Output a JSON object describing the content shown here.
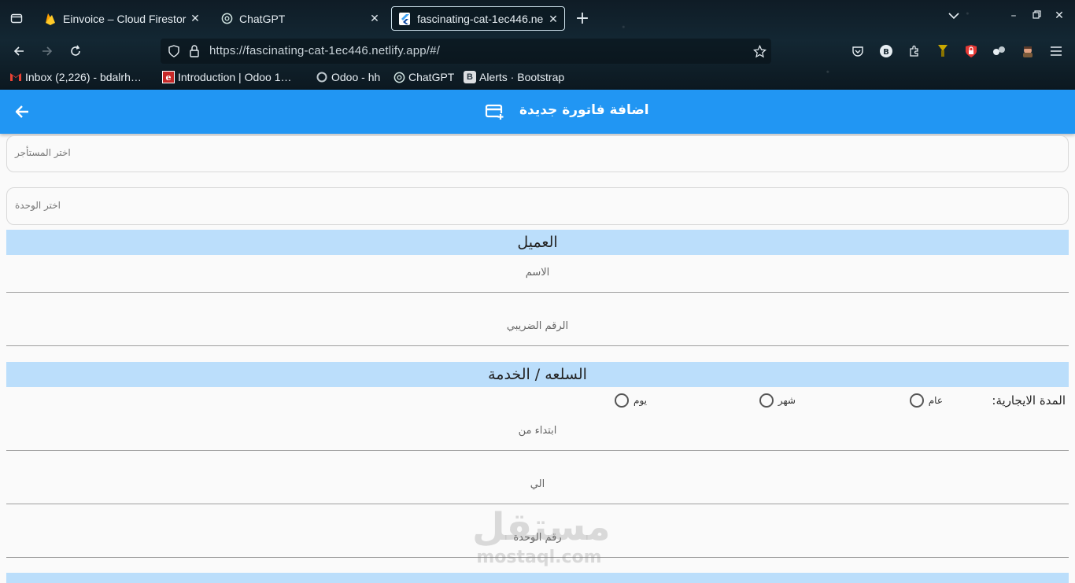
{
  "browser": {
    "tabs": [
      {
        "title": "Einvoice – Cloud Firestor",
        "icon": "firebase-icon",
        "active": false
      },
      {
        "title": "ChatGPT",
        "icon": "chatgpt-icon",
        "active": false
      },
      {
        "title": "fascinating-cat-1ec446.ne",
        "icon": "flutter-icon",
        "active": true
      }
    ],
    "url": "https://fascinating-cat-1ec446.netlify.app/#/",
    "bookmarks": [
      {
        "label": "Inbox (2,226) - bdalrh…",
        "icon": "gmail-icon"
      },
      {
        "label": "Introduction | Odoo 1…",
        "icon": "odoo-doc-icon"
      },
      {
        "label": "Odoo - hh",
        "icon": "odoo-icon"
      },
      {
        "label": "ChatGPT",
        "icon": "chatgpt-icon"
      },
      {
        "label": "Alerts · Bootstrap",
        "icon": "bootstrap-icon"
      }
    ]
  },
  "appbar": {
    "title": "اضافة فاتورة جديدة",
    "icon": "add-card-icon",
    "color": "#2196f3"
  },
  "form": {
    "tenant_hint": "اختر المستأجر",
    "unit_hint": "اختر الوحدة",
    "customer_section": "العميل",
    "name_label": "الاسم",
    "tax_label": "الرقم الضريبي",
    "product_section": "السلعه / الخدمة",
    "period_caption": "المدة الايجارية:",
    "period_options": [
      "عام",
      "شهر",
      "يوم"
    ],
    "from_label": "ابتداء من",
    "to_label": "الي",
    "unit_no_label": "رقم الوحدة",
    "section_color": "#bbdefb"
  },
  "watermark": {
    "arabic": "مستقل",
    "latin": "mostaql.com"
  }
}
